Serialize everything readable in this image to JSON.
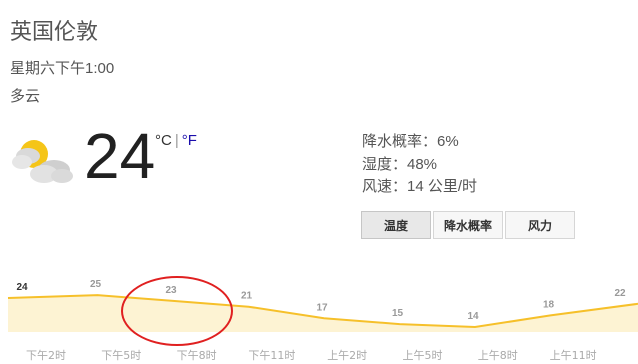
{
  "location": "英国伦敦",
  "datetime": "星期六下午1:00",
  "condition": "多云",
  "icon": "partly-cloudy-icon",
  "temperature": "24",
  "units": {
    "celsius": "°C",
    "separator": "|",
    "fahrenheit": "°F"
  },
  "details": {
    "precip": "降水概率：6%",
    "humidity": "湿度：48%",
    "wind": "风速：14 公里/时"
  },
  "tabs": [
    {
      "label": "温度",
      "active": true
    },
    {
      "label": "降水概率",
      "active": false
    },
    {
      "label": "风力",
      "active": false
    }
  ],
  "colors": {
    "line": "#f6c02a",
    "fill": "#fdf3d3",
    "circle": "#e02020",
    "link": "#1a0dab"
  },
  "chart_data": {
    "type": "area",
    "x": [
      "下午2时",
      "下午5时",
      "下午8时",
      "下午11时",
      "上午2时",
      "上午5时",
      "上午8时",
      "上午11时"
    ],
    "values": [
      24,
      25,
      23,
      21,
      17,
      15,
      14,
      18,
      22
    ],
    "labels": [
      "24",
      "25",
      "23",
      "21",
      "17",
      "15",
      "14",
      "18",
      "22"
    ]
  }
}
